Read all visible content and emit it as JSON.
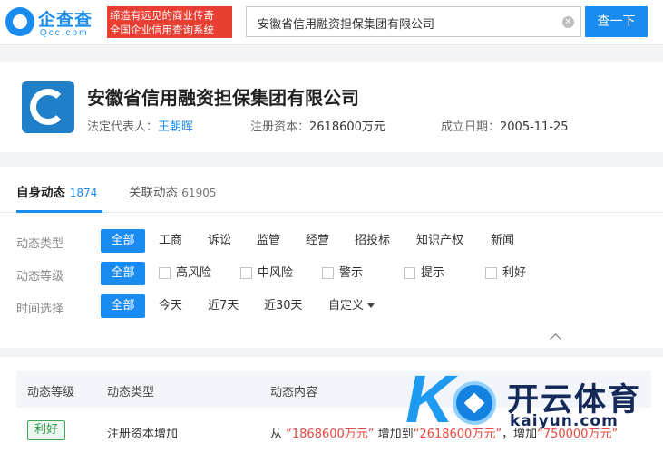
{
  "header": {
    "logo_cn": "企查查",
    "logo_en": "Qcc.com",
    "slogan_line1": "缔造有远见的商业传奇",
    "slogan_line2": "全国企业信用查询系统",
    "search_value": "安徽省信用融资担保集团有限公司",
    "search_button": "查一下"
  },
  "company": {
    "name": "安徽省信用融资担保集团有限公司",
    "legal_rep_label": "法定代表人：",
    "legal_rep": "王朝晖",
    "capital_label": "注册资本：",
    "capital": "2618600万元",
    "founded_label": "成立日期：",
    "founded": "2005-11-25"
  },
  "tabs": [
    {
      "label": "自身动态",
      "count": "1874"
    },
    {
      "label": "关联动态",
      "count": "61905"
    }
  ],
  "filters": {
    "type_label": "动态类型",
    "type_options": [
      "全部",
      "工商",
      "诉讼",
      "监管",
      "经营",
      "招投标",
      "知识产权",
      "新闻"
    ],
    "level_label": "动态等级",
    "level_options": [
      "全部",
      "高风险",
      "中风险",
      "警示",
      "提示",
      "利好"
    ],
    "time_label": "时间选择",
    "time_options": [
      "全部",
      "今天",
      "近7天",
      "近30天",
      "自定义"
    ]
  },
  "table": {
    "columns": [
      "动态等级",
      "动态类型",
      "动态内容"
    ],
    "rows": [
      {
        "level": "利好",
        "type": "注册资本增加",
        "content_from": "从",
        "old_value": "“1868600万元”",
        "mid": "增加到",
        "new_value": "“2618600万元”",
        "sep": "，增加",
        "delta": "“750000万元”"
      }
    ]
  },
  "watermark": {
    "brand_cn": "开云体育",
    "brand_en": "kaiyun.com"
  },
  "colors": {
    "accent": "#1a8cf0",
    "slogan_bg": "#e93f33",
    "positive": "#2e9a4a",
    "highlight_red": "#e5483d"
  }
}
